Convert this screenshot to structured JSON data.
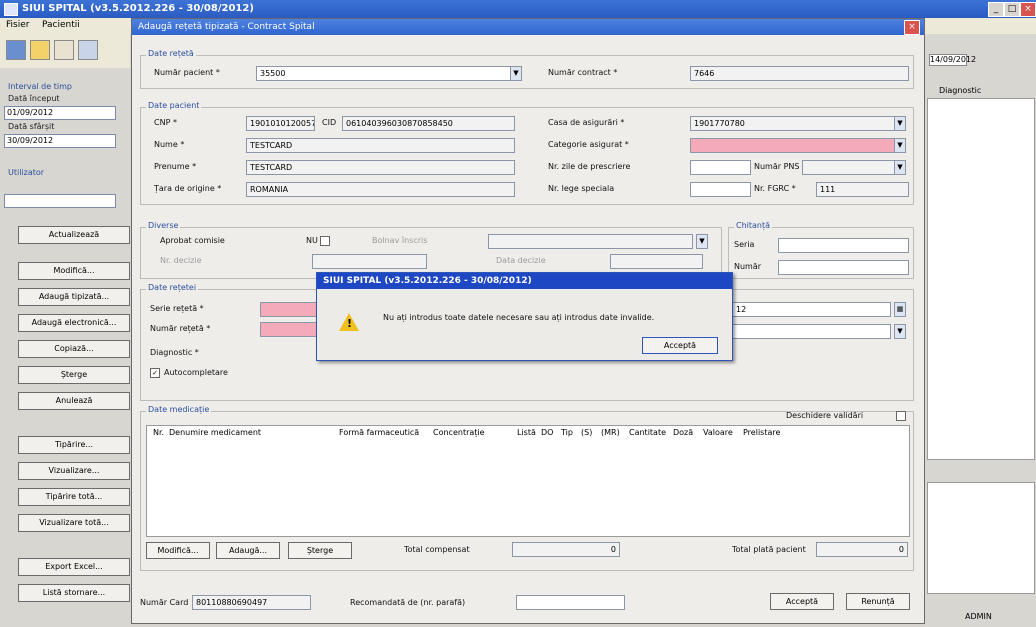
{
  "main_window": {
    "title": "SIUI SPITAL (v3.5.2012.226 - 30/08/2012)",
    "menu": [
      "Fisier",
      "Pacientii"
    ],
    "right_header_date": "14/09/2012",
    "right_header_col": "Diagnostic",
    "status_right": "ADMIN"
  },
  "left_panel": {
    "interval_label": "Interval de timp",
    "start_label": "Dată început",
    "start_value": "01/09/2012",
    "end_label": "Dată sfârșit",
    "end_value": "30/09/2012",
    "user_label": "Utilizator",
    "buttons": [
      "Actualizează",
      "Modifică...",
      "Adaugă tipizată...",
      "Adaugă electronică...",
      "Copiază...",
      "Șterge",
      "Anulează",
      "Tipărire...",
      "Vizualizare...",
      "Tipărire totă...",
      "Vizualizare totă...",
      "Export Excel...",
      "Listă stornare..."
    ]
  },
  "dialog": {
    "title": "Adaugă rețetă tipizată - Contract Spital",
    "date_retete": {
      "title": "Date rețetă",
      "numar_pacient_label": "Număr pacient *",
      "numar_pacient_value": "35500",
      "numar_contract_label": "Număr contract *",
      "numar_contract_value": "7646"
    },
    "date_pacient": {
      "title": "Date pacient",
      "cnp_label": "CNP *",
      "cnp_value": "1901010120057",
      "cid_label": "CID",
      "cid_value": "061040396030870858450",
      "nume_label": "Nume *",
      "nume_value": "TESTCARD",
      "prenume_label": "Prenume *",
      "prenume_value": "TESTCARD",
      "tara_label": "Țara de origine *",
      "tara_value": "ROMANIA",
      "casa_label": "Casa de asigurări *",
      "casa_value": "1901770780",
      "categorie_label": "Categorie asigurat *",
      "nr_zile_label": "Nr. zile de prescriere",
      "nr_lege_label": "Nr. lege speciala",
      "nr_pns_label": "Număr PNS",
      "nr_fgrc_label": "Nr. FGRC *",
      "nr_fgrc_value": "111"
    },
    "diverse": {
      "title": "Diverse",
      "aprobat_label": "Aprobat comisie",
      "aprobat_value": "NU",
      "bolnav_label": "Bolnav înscris",
      "nr_decizie_label": "Nr. decizie",
      "data_decizie_label": "Data decizie"
    },
    "chitanta": {
      "title": "Chitanță",
      "seria_label": "Seria",
      "numar_label": "Număr"
    },
    "date_retetei": {
      "title": "Date rețetei",
      "serie_label": "Serie rețetă *",
      "numar_label": "Număr rețetă *",
      "diagnostic_label": "Diagnostic *",
      "autocompletare_label": "Autocompletare",
      "data_value": "12"
    },
    "medicatie": {
      "title": "Date medicație",
      "deschidere_label": "Deschidere validări",
      "columns": [
        "Nr.",
        "Denumire medicament",
        "Formă farmaceutică",
        "Concentrație",
        "Listă",
        "DO",
        "Tip",
        "(S)",
        "(MR)",
        "Cantitate",
        "Doză",
        "Valoare",
        "Prelistare"
      ],
      "modifica_btn": "Modifică...",
      "adauga_btn": "Adaugă...",
      "sterge_btn": "Șterge",
      "total_comp_label": "Total compensat",
      "total_comp_value": "0",
      "total_plata_label": "Total plată pacient",
      "total_plata_value": "0"
    },
    "bottom": {
      "numar_card_label": "Număr Card",
      "numar_card_value": "80110880690497",
      "recomandat_label": "Recomandată de (nr. parafă)",
      "accepta_btn": "Acceptă",
      "renunta_btn": "Renunță"
    }
  },
  "message_box": {
    "title": "SIUI SPITAL (v3.5.2012.226 - 30/08/2012)",
    "text": "Nu ați introdus toate datele necesare sau ați introdus date invalide.",
    "button": "Acceptă"
  },
  "colors": {
    "title_blue": "#2a5bc2",
    "required_pink": "#f4aab8",
    "msg_title": "#1e47c4",
    "warning": "#f0c020"
  }
}
